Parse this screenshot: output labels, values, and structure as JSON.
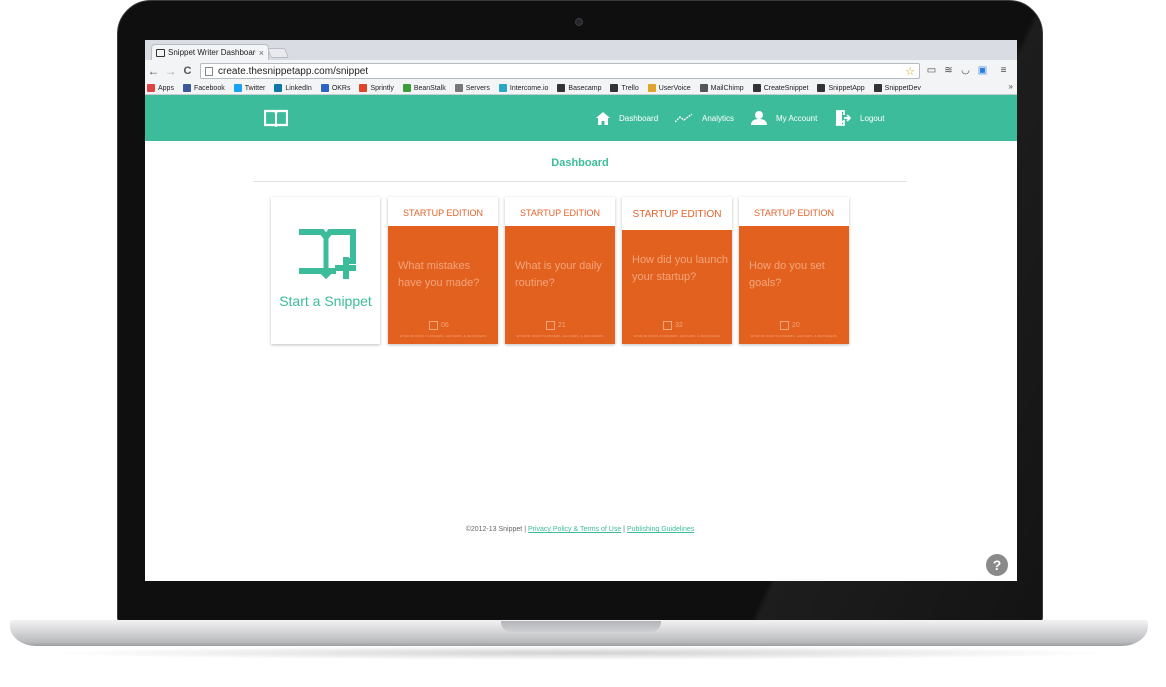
{
  "browser": {
    "tab_title": "Snippet Writer Dashboard",
    "tab_close": "×",
    "url": "create.thesnippetapp.com/snippet",
    "back": "←",
    "forward": "→",
    "reload": "C",
    "star": "☆",
    "bookmarks": [
      {
        "label": "Apps",
        "icon": "apps-icon",
        "color": "#d44"
      },
      {
        "label": "Facebook",
        "icon": "facebook-icon",
        "color": "#3b5998"
      },
      {
        "label": "Twitter",
        "icon": "twitter-icon",
        "color": "#1da1f2"
      },
      {
        "label": "LinkedIn",
        "icon": "linkedin-icon",
        "color": "#0e76a8"
      },
      {
        "label": "OKRs",
        "icon": "okrs-icon",
        "color": "#2b63c8"
      },
      {
        "label": "Sprintly",
        "icon": "sprintly-icon",
        "color": "#e0442c"
      },
      {
        "label": "BeanStalk",
        "icon": "beanstalk-icon",
        "color": "#3a9d3a"
      },
      {
        "label": "Servers",
        "icon": "servers-icon",
        "color": "#777"
      },
      {
        "label": "Intercome.io",
        "icon": "intercom-icon",
        "color": "#2aa6c6"
      },
      {
        "label": "Basecamp",
        "icon": "basecamp-icon",
        "color": "#333"
      },
      {
        "label": "Trello",
        "icon": "trello-icon",
        "color": "#333"
      },
      {
        "label": "UserVoice",
        "icon": "uservoice-icon",
        "color": "#e2a32c"
      },
      {
        "label": "MailChimp",
        "icon": "mailchimp-icon",
        "color": "#555"
      },
      {
        "label": "CreateSnippet",
        "icon": "book-icon",
        "color": "#333"
      },
      {
        "label": "SnippetApp",
        "icon": "book-icon",
        "color": "#333"
      },
      {
        "label": "SnippetDev",
        "icon": "book-icon",
        "color": "#333"
      }
    ],
    "bookmarks_more": "»"
  },
  "app": {
    "nav": {
      "dashboard": "Dashboard",
      "analytics": "Analytics",
      "my_account": "My Account",
      "logout": "Logout"
    },
    "page_title": "Dashboard",
    "start_label": "Start a Snippet",
    "cards": [
      {
        "edition": "STARTUP EDITION",
        "question": "What mistakes have you made?",
        "number": "06",
        "subtitle": "WISDOM FROM FOUNDERS, HACKERS, & DESIGNERS"
      },
      {
        "edition": "STARTUP EDITION",
        "question": "What is your daily routine?",
        "number": "21",
        "subtitle": "WISDOM FROM FOUNDERS, HACKERS, & DESIGNERS"
      },
      {
        "edition": "STARTUP EDITION",
        "question": "How did you launch your startup?",
        "number": "32",
        "subtitle": "WISDOM FROM FOUNDERS, HACKERS, & DESIGNERS"
      },
      {
        "edition": "STARTUP EDITION",
        "question": "How do you set goals?",
        "number": "20",
        "subtitle": "WISDOM FROM FOUNDERS, HACKERS, & DESIGNERS"
      }
    ],
    "footer": {
      "copyright": "©2012-13 Snippet",
      "sep": "|",
      "privacy": "Privacy Policy & Terms of Use",
      "guidelines": "Publishing Guidelines"
    },
    "help": "?",
    "colors": {
      "accent": "#3dbc9c",
      "card_orange": "#e2611f"
    }
  }
}
